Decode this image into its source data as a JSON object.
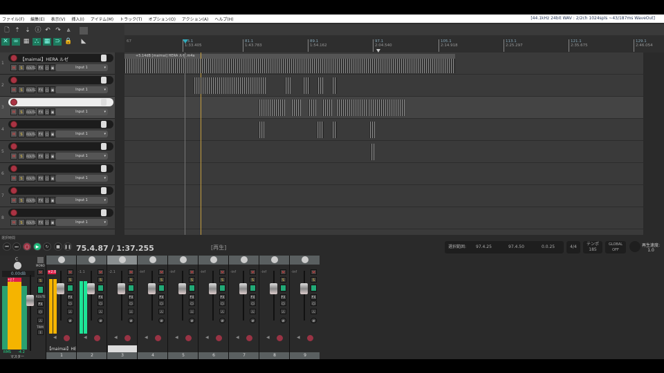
{
  "menu": [
    "ファイル(F)",
    "編集(E)",
    "表示(V)",
    "挿入(I)",
    "アイテム(M)",
    "トラック(T)",
    "オプション(O)",
    "アクション(A)",
    "ヘルプ(H)"
  ],
  "audio_info": "[44.1kHz 24bit WAV : 2/2ch 1024spls ~43/187ms WaveOut]",
  "ruler": {
    "start_label": "67",
    "markers": [
      {
        "bar": "73.1",
        "time": "1:33.405"
      },
      {
        "bar": "81.1",
        "time": "1:43.783"
      },
      {
        "bar": "89.1",
        "time": "1:54.162"
      },
      {
        "bar": "97.1",
        "time": "2:04.540"
      },
      {
        "bar": "105.1",
        "time": "2:14.918"
      },
      {
        "bar": "113.1",
        "time": "2:25.297"
      },
      {
        "bar": "121.1",
        "time": "2:35.675"
      },
      {
        "bar": "129.1",
        "time": "2:46.054"
      }
    ]
  },
  "item_label": "+5.14dB [maimai] HERA ルゼ.m4a",
  "tracks": [
    {
      "num": "1",
      "name": "【maimai】HERA ルゼ",
      "input": "Input 1",
      "selected": false
    },
    {
      "num": "2",
      "name": "",
      "input": "Input 1",
      "selected": false
    },
    {
      "num": "3",
      "name": "",
      "input": "Input 1",
      "selected": true
    },
    {
      "num": "4",
      "name": "",
      "input": "Input 1",
      "selected": false
    },
    {
      "num": "5",
      "name": "",
      "input": "Input 1",
      "selected": false
    },
    {
      "num": "6",
      "name": "",
      "input": "Input 1",
      "selected": false
    },
    {
      "num": "7",
      "name": "",
      "input": "Input 1",
      "selected": false
    },
    {
      "num": "8",
      "name": "",
      "input": "Input 1",
      "selected": false
    }
  ],
  "track_buttons": {
    "mute": "M",
    "solo": "S",
    "route": "ROUTE",
    "fx": "FX"
  },
  "transport": {
    "label": "選択時間",
    "position": "75.4.87 / 1:37.255",
    "state": "[再生]"
  },
  "selection": {
    "label": "選択範囲:",
    "start": "97.4.25",
    "end": "97.4.50",
    "length": "0.0.25"
  },
  "time_sig": "4/4",
  "tempo": {
    "label": "テンポ",
    "value": "185"
  },
  "global": {
    "label": "GLOBAL",
    "value": "OFF"
  },
  "rate": {
    "label": "再生速度:",
    "value": "1.0"
  },
  "master": {
    "pan": "C",
    "volume": "0.00dB",
    "peak_l": "+2.7",
    "peak_r": "+2.0",
    "rms_label": "RMS",
    "rms_value": "-4.2",
    "name": "マスター",
    "mono": "MONO",
    "route": "ROUTE",
    "trim": "TRIM"
  },
  "mixer_strips": [
    {
      "num": "1",
      "level": "+2.0",
      "name": "【maimai】HEI",
      "meter": 0.95,
      "meter_color": "#f5b400"
    },
    {
      "num": "2",
      "level": "-1.1",
      "name": "",
      "meter": 0.92,
      "meter_color": "#1de597"
    },
    {
      "num": "3",
      "level": "-2.1",
      "name": "",
      "meter": 0,
      "meter_color": "#1de597"
    },
    {
      "num": "4",
      "level": "-inf",
      "name": "",
      "meter": 0,
      "meter_color": "#1de597"
    },
    {
      "num": "5",
      "level": "-inf",
      "name": "",
      "meter": 0,
      "meter_color": "#1de597"
    },
    {
      "num": "6",
      "level": "-inf",
      "name": "",
      "meter": 0,
      "meter_color": "#1de597"
    },
    {
      "num": "7",
      "level": "-inf",
      "name": "",
      "meter": 0,
      "meter_color": "#1de597"
    },
    {
      "num": "8",
      "level": "-inf",
      "name": "",
      "meter": 0,
      "meter_color": "#1de597"
    },
    {
      "num": "9",
      "level": "-inf",
      "name": "",
      "meter": 0,
      "meter_color": "#1de597"
    }
  ],
  "colors": {
    "accent": "#1e7a5e",
    "record": "#a33344",
    "play": "#1db87a",
    "meter_yellow": "#f5b400",
    "meter_green": "#1de597"
  }
}
